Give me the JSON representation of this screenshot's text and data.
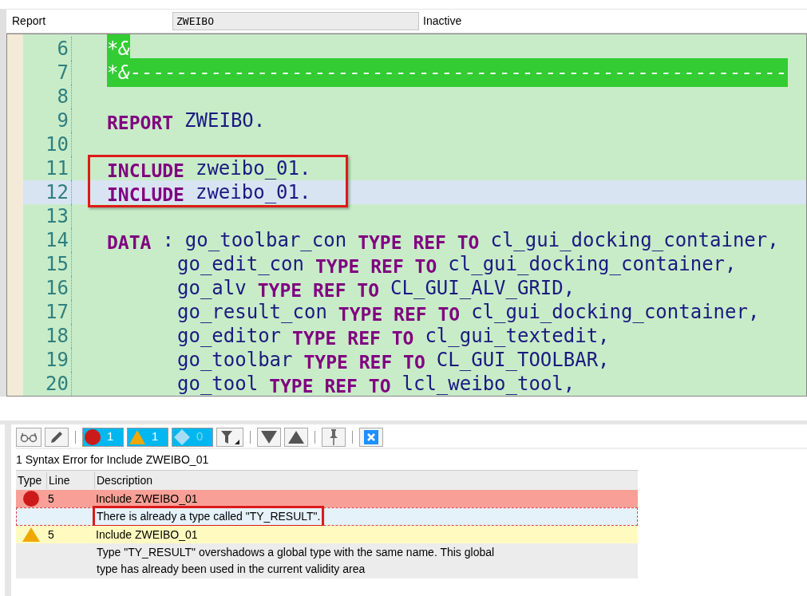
{
  "header": {
    "label": "Report",
    "program": "ZWEIBO",
    "status": "Inactive"
  },
  "editor": {
    "lines": [
      {
        "number": "6",
        "highlighted": false,
        "annotated": false,
        "continuation": false,
        "tokens": [
          {
            "kind": "comment",
            "text": "*&"
          }
        ]
      },
      {
        "number": "7",
        "highlighted": false,
        "annotated": false,
        "continuation": false,
        "tokens": [
          {
            "kind": "comment",
            "text": "*&---------------------------------------------------------"
          }
        ]
      },
      {
        "number": "8",
        "highlighted": false,
        "annotated": false,
        "continuation": false
      },
      {
        "number": "9",
        "highlighted": false,
        "annotated": false,
        "continuation": false,
        "tokens": [
          {
            "kind": "keyword",
            "text": "REPORT"
          },
          {
            "kind": "name",
            "text": "ZWEIBO."
          }
        ]
      },
      {
        "number": "10",
        "highlighted": false,
        "annotated": false,
        "continuation": false
      },
      {
        "number": "11",
        "highlighted": false,
        "annotated": true,
        "continuation": false,
        "tokens": [
          {
            "kind": "keyword",
            "text": "INCLUDE"
          },
          {
            "kind": "name",
            "text": "zweibo_01."
          }
        ]
      },
      {
        "number": "12",
        "highlighted": true,
        "annotated": true,
        "continuation": false,
        "tokens": [
          {
            "kind": "keyword",
            "text": "INCLUDE"
          },
          {
            "kind": "name",
            "text": "zweibo_01."
          }
        ]
      },
      {
        "number": "13",
        "highlighted": false,
        "annotated": false,
        "continuation": false
      },
      {
        "number": "14",
        "highlighted": false,
        "annotated": false,
        "continuation": false,
        "tokens": [
          {
            "kind": "keyword",
            "text": "DATA"
          },
          {
            "kind": "punct",
            "text": ":"
          },
          {
            "kind": "name",
            "text": "go_toolbar_con"
          },
          {
            "kind": "keyword",
            "text": "TYPE REF TO"
          },
          {
            "kind": "name",
            "text": "cl_gui_docking_container,"
          }
        ]
      },
      {
        "number": "15",
        "highlighted": false,
        "annotated": false,
        "continuation": true,
        "tokens": [
          {
            "kind": "name",
            "text": "go_edit_con"
          },
          {
            "kind": "keyword",
            "text": "TYPE REF TO"
          },
          {
            "kind": "name",
            "text": "cl_gui_docking_container,"
          }
        ]
      },
      {
        "number": "16",
        "highlighted": false,
        "annotated": false,
        "continuation": true,
        "tokens": [
          {
            "kind": "name",
            "text": "go_alv"
          },
          {
            "kind": "keyword",
            "text": "TYPE REF TO"
          },
          {
            "kind": "name",
            "text": "CL_GUI_ALV_GRID,"
          }
        ]
      },
      {
        "number": "17",
        "highlighted": false,
        "annotated": false,
        "continuation": true,
        "tokens": [
          {
            "kind": "name",
            "text": "go_result_con"
          },
          {
            "kind": "keyword",
            "text": "TYPE REF TO"
          },
          {
            "kind": "name",
            "text": "cl_gui_docking_container,"
          }
        ]
      },
      {
        "number": "18",
        "highlighted": false,
        "annotated": false,
        "continuation": true,
        "tokens": [
          {
            "kind": "name",
            "text": "go_editor"
          },
          {
            "kind": "keyword",
            "text": "TYPE REF TO"
          },
          {
            "kind": "name",
            "text": "cl_gui_textedit,"
          }
        ]
      },
      {
        "number": "19",
        "highlighted": false,
        "annotated": false,
        "continuation": true,
        "tokens": [
          {
            "kind": "name",
            "text": "go_toolbar"
          },
          {
            "kind": "keyword",
            "text": "TYPE REF TO"
          },
          {
            "kind": "name",
            "text": "CL_GUI_TOOLBAR,"
          }
        ]
      },
      {
        "number": "20",
        "highlighted": false,
        "annotated": false,
        "continuation": true,
        "tokens": [
          {
            "kind": "name",
            "text": "go_tool"
          },
          {
            "kind": "keyword",
            "text": "TYPE REF TO"
          },
          {
            "kind": "name",
            "text": "lcl_weibo_tool,"
          }
        ]
      }
    ]
  },
  "toolbar": [
    {
      "kind": "glasses"
    },
    {
      "kind": "pencil"
    },
    {
      "kind": "separator"
    },
    {
      "kind": "errors",
      "count": "1",
      "selected": true,
      "disabled": false
    },
    {
      "kind": "warnings",
      "count": "1",
      "selected": true,
      "disabled": false
    },
    {
      "kind": "infos",
      "count": "0",
      "selected": true,
      "disabled": true
    },
    {
      "kind": "filter"
    },
    {
      "kind": "separator"
    },
    {
      "kind": "next"
    },
    {
      "kind": "previous"
    },
    {
      "kind": "separator"
    },
    {
      "kind": "pin"
    },
    {
      "kind": "separator"
    },
    {
      "kind": "close"
    }
  ],
  "messages": {
    "title": "1 Syntax Error for Include ZWEIBO_01",
    "columns": [
      "Type",
      "Line",
      "Description"
    ],
    "rows": [
      {
        "kind": "error",
        "line": "5",
        "description": "Include ZWEIBO_01"
      },
      {
        "kind": "detail",
        "selected": true,
        "annotated": true,
        "description": "There is already a type called \"TY_RESULT\"."
      },
      {
        "kind": "warning",
        "line": "5",
        "description": "Include ZWEIBO_01"
      },
      {
        "kind": "detail",
        "selected": false,
        "annotated": false,
        "description": "Type \"TY_RESULT\" overshadows a global type with the same name. This global type has already been used in the current validity area"
      }
    ]
  }
}
